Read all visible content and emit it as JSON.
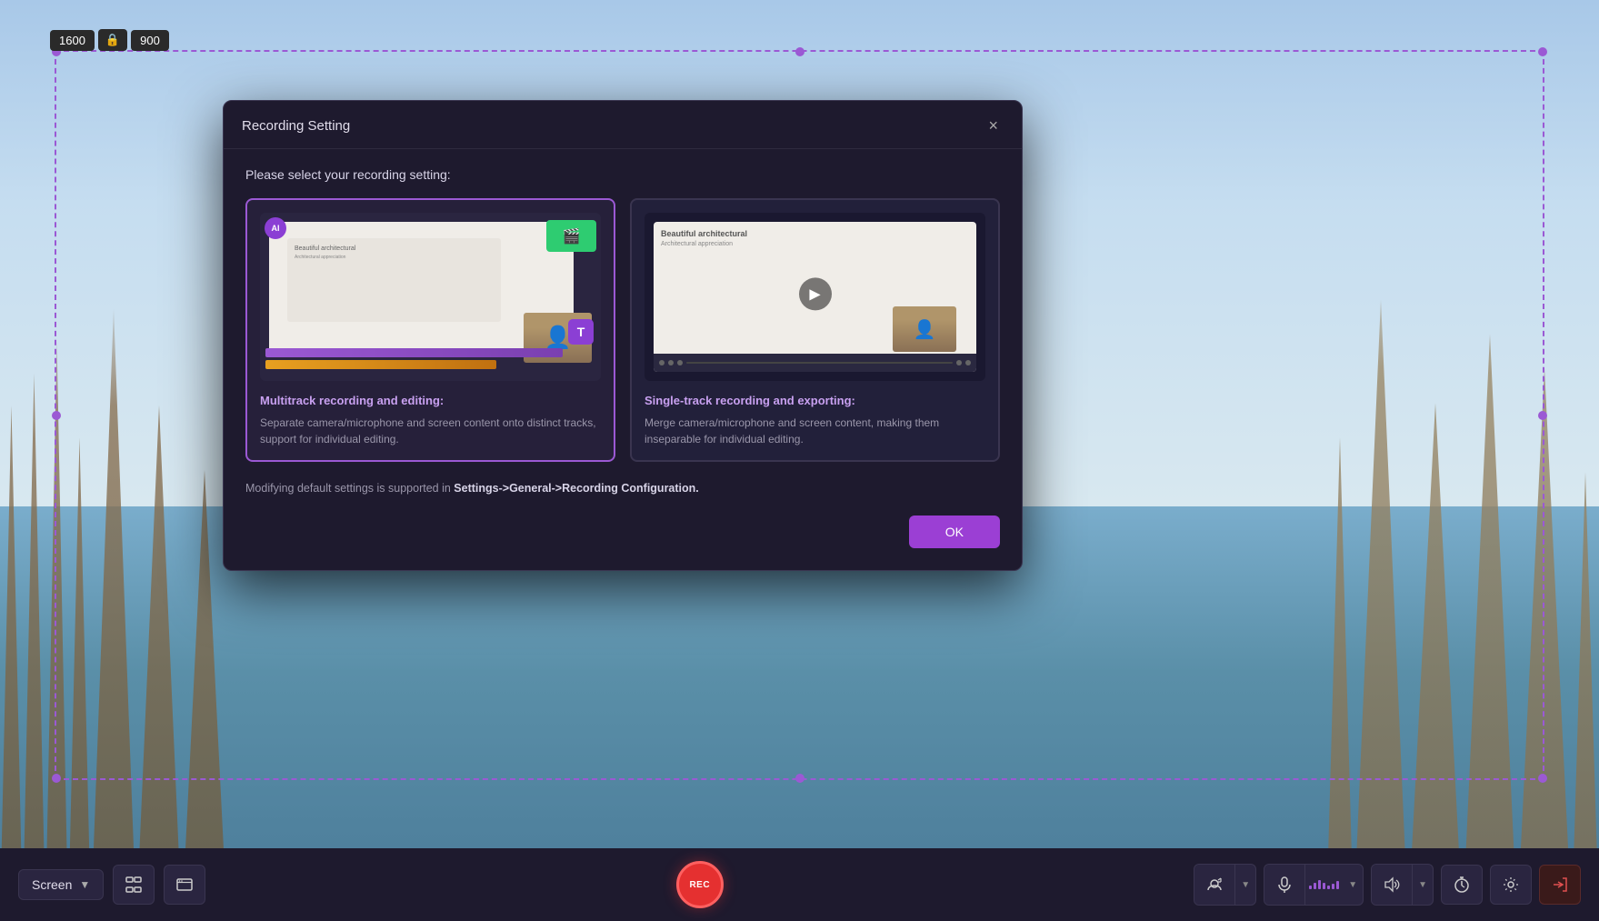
{
  "background": {
    "sky_color": "#a8c8e8",
    "water_color": "#5a8fa8"
  },
  "size_indicator": {
    "width": "1600",
    "height": "900",
    "lock_icon": "🔒"
  },
  "modal": {
    "title": "Recording Setting",
    "close_label": "×",
    "subtitle": "Please select your recording setting:",
    "options": [
      {
        "id": "multitrack",
        "title": "Multitrack recording and editing:",
        "description": "Separate camera/microphone and screen content onto distinct tracks, support for individual editing.",
        "selected": true,
        "ai_badge": "AI"
      },
      {
        "id": "singletrack",
        "title": "Single-track recording and exporting:",
        "description": "Merge camera/microphone and screen content, making them inseparable for individual editing.",
        "selected": false
      }
    ],
    "note_prefix": "Modifying default settings is supported in ",
    "note_link": "Settings->General->Recording Configuration.",
    "ok_label": "OK"
  },
  "toolbar": {
    "screen_label": "Screen",
    "fullscreen_icon": "⛶",
    "window_icon": "▢",
    "rec_label": "REC",
    "webcam_icon": "📷",
    "mic_icon": "🎤",
    "speaker_icon": "🔊",
    "timer_icon": "⏱",
    "settings_icon": "⚙",
    "exit_icon": "⬛"
  }
}
